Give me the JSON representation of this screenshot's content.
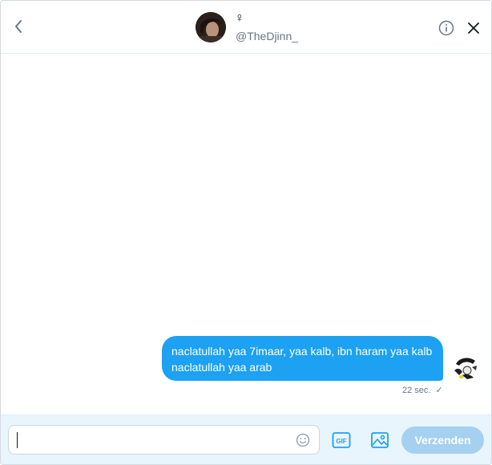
{
  "header": {
    "name": "♀",
    "handle": "@TheDjinn_"
  },
  "message": {
    "lines": [
      "naclatullah yaa 7imaar, yaa kalb, ibn haram yaa kalb",
      "naclatullah yaa arab"
    ],
    "time": "22 sec.",
    "status_mark": "✓"
  },
  "composer": {
    "input_value": "",
    "send_label": "Verzenden"
  },
  "colors": {
    "accent": "#1da1f2",
    "send_disabled": "#a5d0f0",
    "composer_bg": "#e8f5fd",
    "secondary_text": "#657786"
  },
  "icons": {
    "back": "chevron-left-icon",
    "info": "info-icon",
    "close": "close-icon",
    "emoji": "smiley-icon",
    "gif": "gif-icon",
    "media": "image-icon"
  }
}
